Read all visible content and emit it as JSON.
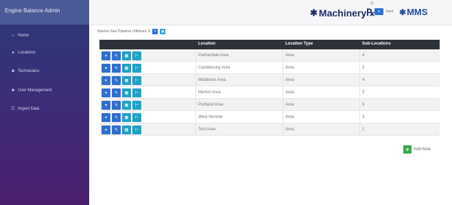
{
  "sidebar": {
    "brand": "Engine Balance Admin",
    "items": [
      {
        "label": "Home",
        "icon": "home-icon"
      },
      {
        "label": "Locations",
        "icon": "map-marker-icon"
      },
      {
        "label": "Technicians",
        "icon": "users-icon"
      },
      {
        "label": "User Management",
        "icon": "user-cog-icon"
      },
      {
        "label": "Import Data",
        "icon": "database-icon"
      }
    ]
  },
  "header": {
    "logo_machinery": "MachineryRx",
    "logo_machinery_main": "Machinery",
    "logo_machinery_rx": "℞",
    "user_name": "Kent",
    "logo_mms": "MMS"
  },
  "breadcrumb": {
    "text": "Marine Gas Pipeline Offshore S"
  },
  "table": {
    "headers": [
      "Location",
      "Location Type",
      "Sub-Locations"
    ],
    "rows": [
      {
        "location": "Palmerdale Area",
        "type": "Area",
        "sub": "4"
      },
      {
        "location": "Castlebourg Area",
        "type": "Area",
        "sub": "3"
      },
      {
        "location": "Middleton Area",
        "type": "Area",
        "sub": "4"
      },
      {
        "location": "Merton Area",
        "type": "Area",
        "sub": "5"
      },
      {
        "location": "Portland Area",
        "type": "Area",
        "sub": "3"
      },
      {
        "location": "West Monroe",
        "type": "Area",
        "sub": "3"
      },
      {
        "location": "Test Area",
        "type": "Area",
        "sub": "1"
      }
    ]
  },
  "add_area": {
    "label": "Add Area"
  },
  "colors": {
    "accent_blue": "#2f6fcf",
    "accent_teal": "#1fa2c7",
    "add_green": "#3aa84a",
    "table_header": "#2d3138"
  }
}
